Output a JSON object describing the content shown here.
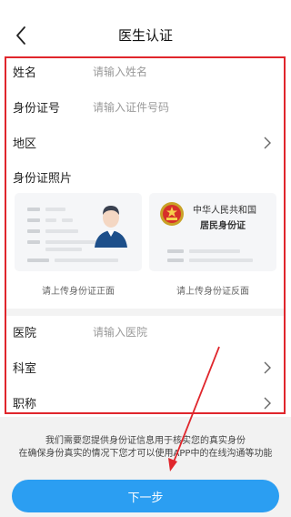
{
  "nav": {
    "title": "医生认证"
  },
  "form": {
    "name": {
      "label": "姓名",
      "placeholder": "请输入姓名"
    },
    "id_number": {
      "label": "身份证号",
      "placeholder": "请输入证件号码"
    },
    "region": {
      "label": "地区"
    },
    "id_photos": {
      "title": "身份证照片",
      "front_caption": "请上传身份证正面",
      "back_caption": "请上传身份证反面",
      "back_card_line1": "中华人民共和国",
      "back_card_line2": "居民身份证"
    },
    "hospital": {
      "label": "医院",
      "placeholder": "请输入医院"
    },
    "department": {
      "label": "科室"
    },
    "title": {
      "label": "职称"
    }
  },
  "notice": {
    "line1": "我们需要您提供身份证信息用于核实您的真实身份",
    "line2": "在确保身份真实的情况下您才可以使用APP中的在线沟通等功能"
  },
  "next_button": {
    "label": "下一步"
  },
  "colors": {
    "highlight_border": "#e0262c",
    "primary_button": "#2b9ef2",
    "annotation_arrow": "#e0262c"
  }
}
